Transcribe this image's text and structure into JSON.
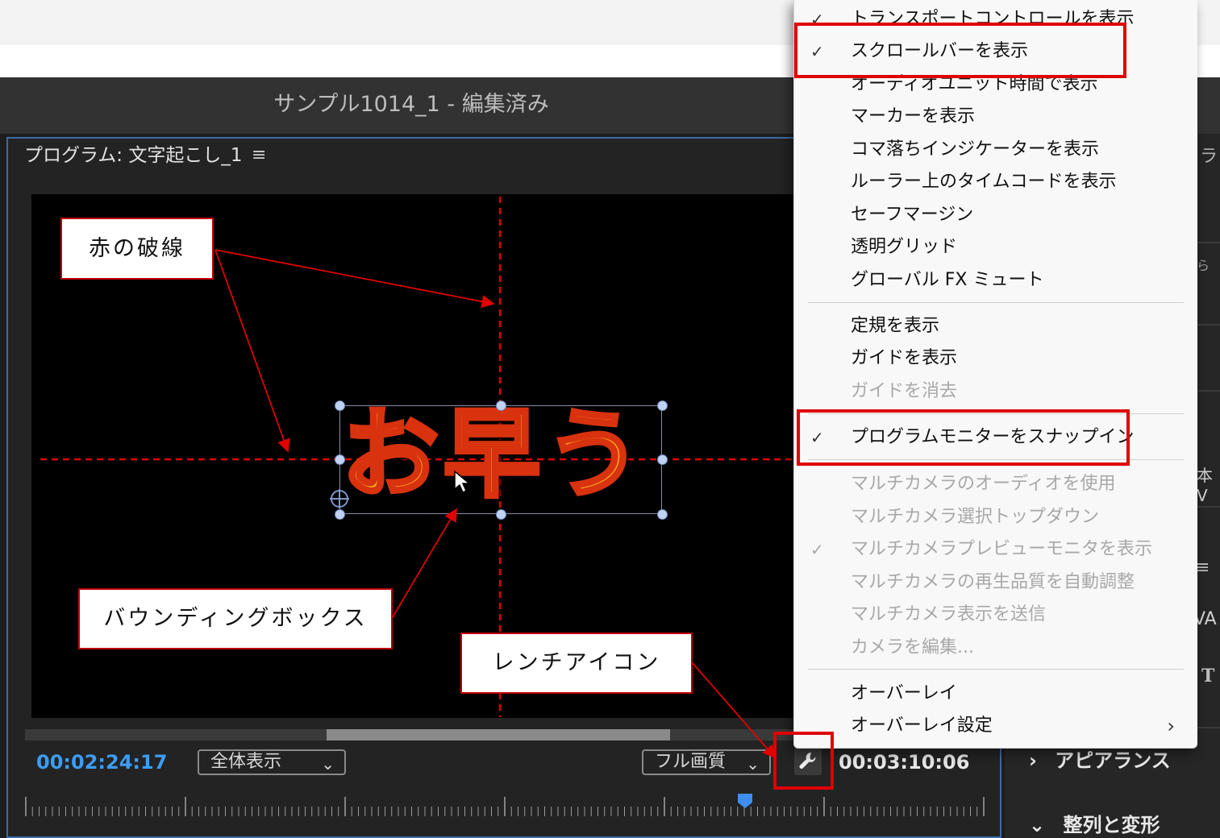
{
  "window": {
    "title": "サンプル1014_1 - 編集済み"
  },
  "monitor": {
    "panel_title": "プログラム: 文字起こし_1",
    "menu_icon": "≡",
    "title_text": "お早う",
    "timecode_current": "00:02:24:17",
    "fit_dropdown": "全体表示",
    "quality_dropdown": "フル画質",
    "timecode_duration": "00:03:10:06",
    "scroll_position": 0.39,
    "playhead_position": 0.75,
    "icons": {
      "menu": "hamburger-icon",
      "wrench": "wrench-icon",
      "anchor": "crosshair-icon",
      "cursor": "arrow-cursor-icon",
      "chevron": "chevron-down-icon"
    }
  },
  "right_panel": {
    "fragments": [
      "ラ",
      "ら",
      "本V",
      "VA",
      "T"
    ],
    "lines_icon": "≡",
    "sections": [
      {
        "label": "アピアランス",
        "chevron": "›"
      },
      {
        "label": "整列と変形",
        "chevron": "⌄"
      }
    ]
  },
  "context_menu": {
    "items": [
      {
        "label": "トランスポートコントロールを表示",
        "checked": true,
        "disabled": false
      },
      {
        "label": "スクロールバーを表示",
        "checked": true,
        "disabled": false
      },
      {
        "label": "オーディオユニット時間で表示",
        "checked": false,
        "disabled": false
      },
      {
        "label": "マーカーを表示",
        "checked": false,
        "disabled": false
      },
      {
        "label": "コマ落ちインジケーターを表示",
        "checked": false,
        "disabled": false
      },
      {
        "label": "ルーラー上のタイムコードを表示",
        "checked": false,
        "disabled": false
      },
      {
        "label": "セーフマージン",
        "checked": false,
        "disabled": false
      },
      {
        "label": "透明グリッド",
        "checked": false,
        "disabled": false
      },
      {
        "label": "グローバル FX ミュート",
        "checked": false,
        "disabled": false
      },
      {
        "label": "定規を表示",
        "checked": false,
        "disabled": false
      },
      {
        "label": "ガイドを表示",
        "checked": false,
        "disabled": false
      },
      {
        "label": "ガイドを消去",
        "checked": false,
        "disabled": true
      },
      {
        "label": "プログラムモニターをスナップイン",
        "checked": true,
        "disabled": false
      },
      {
        "label": "マルチカメラのオーディオを使用",
        "checked": false,
        "disabled": true
      },
      {
        "label": "マルチカメラ選択トップダウン",
        "checked": false,
        "disabled": true
      },
      {
        "label": "マルチカメラプレビューモニタを表示",
        "checked": true,
        "disabled": true
      },
      {
        "label": "マルチカメラの再生品質を自動調整",
        "checked": false,
        "disabled": true
      },
      {
        "label": "マルチカメラ表示を送信",
        "checked": false,
        "disabled": true
      },
      {
        "label": "カメラを編集...",
        "checked": false,
        "disabled": true
      },
      {
        "label": "オーバーレイ",
        "checked": false,
        "disabled": false
      },
      {
        "label": "オーバーレイ設定",
        "checked": false,
        "disabled": false,
        "submenu_arrow": "›"
      }
    ],
    "check_glyph": "✓"
  },
  "annotations": {
    "red_dashed": "赤の破線",
    "bounding_box": "バウンディングボックス",
    "wrench_icon": "レンチアイコン"
  },
  "colors": {
    "accent_blue": "#3d9cf4",
    "annotation_red": "#e00000",
    "guide_red": "#e00000",
    "title_fill": "#ffb020",
    "title_stroke": "#d8320f"
  }
}
